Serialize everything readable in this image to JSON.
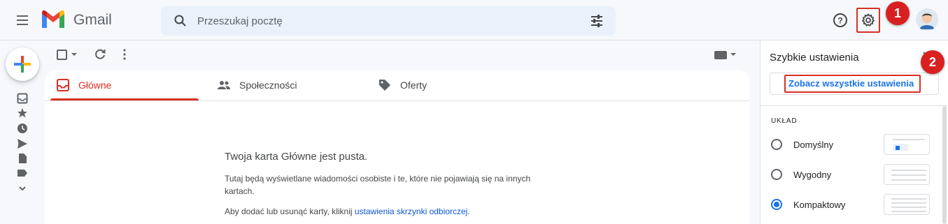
{
  "header": {
    "app_name": "Gmail",
    "search_placeholder": "Przeszukaj pocztę"
  },
  "annotations": {
    "badge_1": "1",
    "badge_2": "2"
  },
  "tabs": [
    {
      "label": "Główne",
      "selected": true
    },
    {
      "label": "Społeczności",
      "selected": false
    },
    {
      "label": "Oferty",
      "selected": false
    }
  ],
  "empty_state": {
    "title": "Twoja karta Główne jest pusta.",
    "description": "Tutaj będą wyświetlane wiadomości osobiste i te, które nie pojawiają się na innych kartach.",
    "hint_prefix": "Aby dodać lub usunąć karty, kliknij ",
    "hint_link": "ustawienia skrzynki odbiorczej",
    "hint_suffix": "."
  },
  "quick_settings": {
    "title": "Szybkie ustawienia",
    "see_all_label": "Zobacz wszystkie ustawienia",
    "section_label": "UKŁAD",
    "density_options": [
      {
        "label": "Domyślny",
        "selected": false
      },
      {
        "label": "Wygodny",
        "selected": false
      },
      {
        "label": "Kompaktowy",
        "selected": true
      }
    ]
  },
  "colors": {
    "accent_red": "#d93025",
    "link_blue": "#1a73e8",
    "badge_red": "#d92020"
  }
}
